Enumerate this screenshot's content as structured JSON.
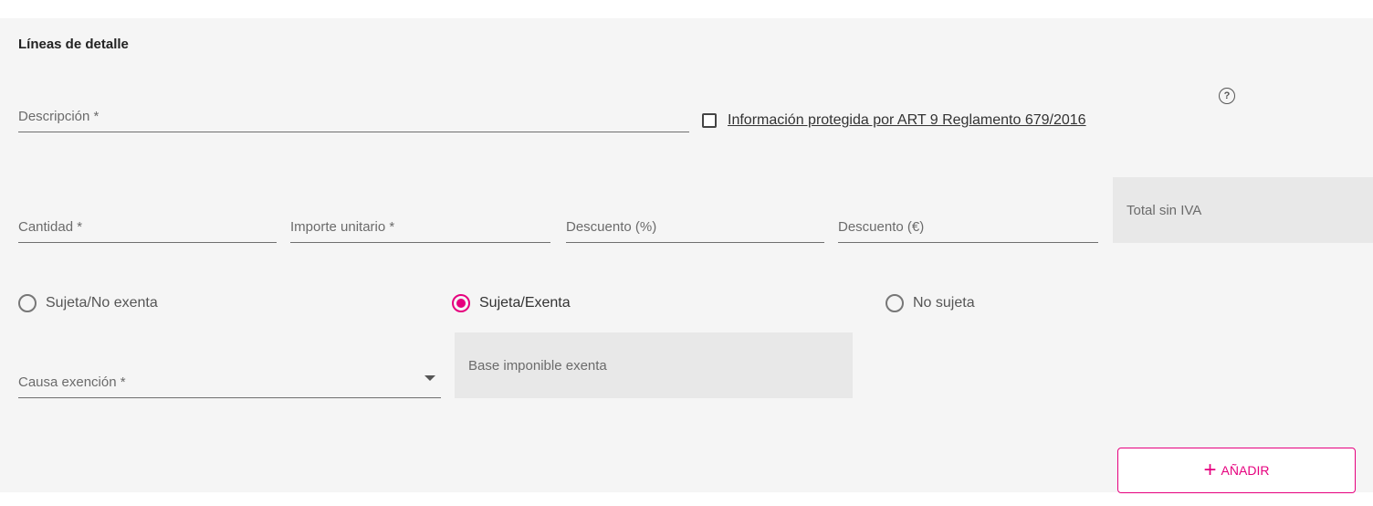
{
  "section": {
    "title": "Líneas de detalle"
  },
  "description": {
    "label": "Descripción *"
  },
  "protected_info": {
    "label": "Información protegida por ART 9 Reglamento 679/2016",
    "checked": false,
    "help_icon": "question-circle-icon"
  },
  "amounts": {
    "quantity_label": "Cantidad *",
    "unit_price_label": "Importe unitario *",
    "discount_pct_label": "Descuento (%)",
    "discount_eur_label": "Descuento (€)",
    "total_label": "Total sin IVA"
  },
  "tax_type": {
    "options": [
      {
        "label": "Sujeta/No exenta",
        "selected": false
      },
      {
        "label": "Sujeta/Exenta",
        "selected": true
      },
      {
        "label": "No sujeta",
        "selected": false
      }
    ]
  },
  "exemption": {
    "cause_label": "Causa exención *",
    "base_label": "Base imponible exenta"
  },
  "actions": {
    "add_label": "AÑADIR",
    "add_icon": "plus-icon"
  },
  "colors": {
    "accent": "#e6007e",
    "panel": "#f5f5f5",
    "readonly": "#e8e8e8"
  }
}
